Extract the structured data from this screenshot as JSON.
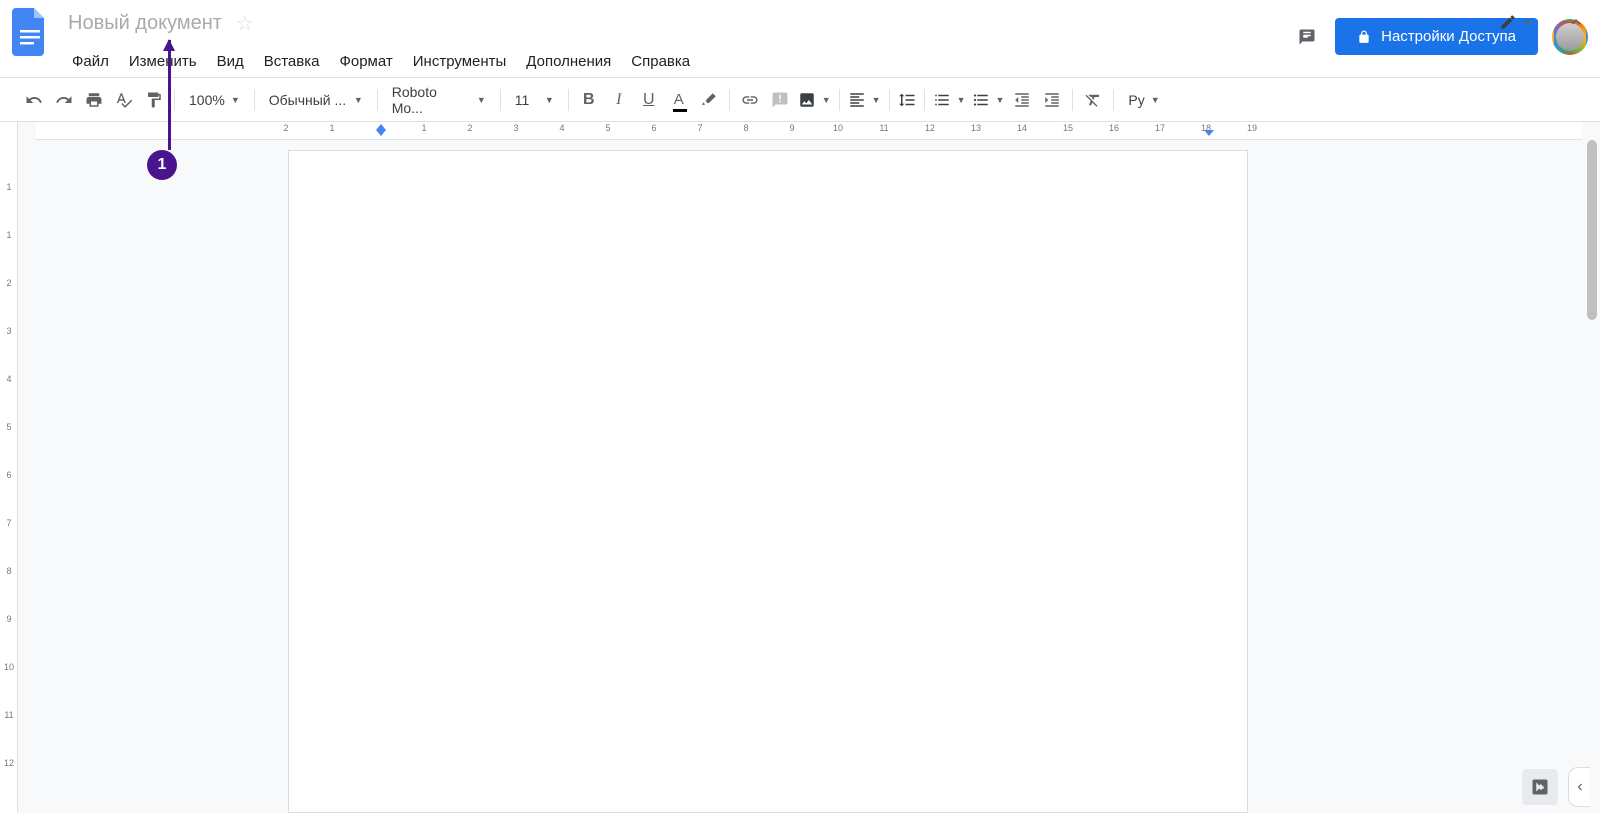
{
  "header": {
    "doc_title": "Новый документ",
    "menus": [
      "Файл",
      "Изменить",
      "Вид",
      "Вставка",
      "Формат",
      "Инструменты",
      "Дополнения",
      "Справка"
    ],
    "share_label": "Настройки Доступа"
  },
  "toolbar": {
    "zoom": "100%",
    "style": "Обычный ...",
    "font": "Roboto Mo...",
    "font_size": "11",
    "input_tool": "Ру"
  },
  "ruler": {
    "h_marks": [
      "2",
      "1",
      "1",
      "2",
      "3",
      "4",
      "5",
      "6",
      "7",
      "8",
      "9",
      "10",
      "11",
      "12",
      "13",
      "14",
      "15",
      "16",
      "17",
      "18",
      "19"
    ]
  },
  "annotation": {
    "badge": "1"
  }
}
